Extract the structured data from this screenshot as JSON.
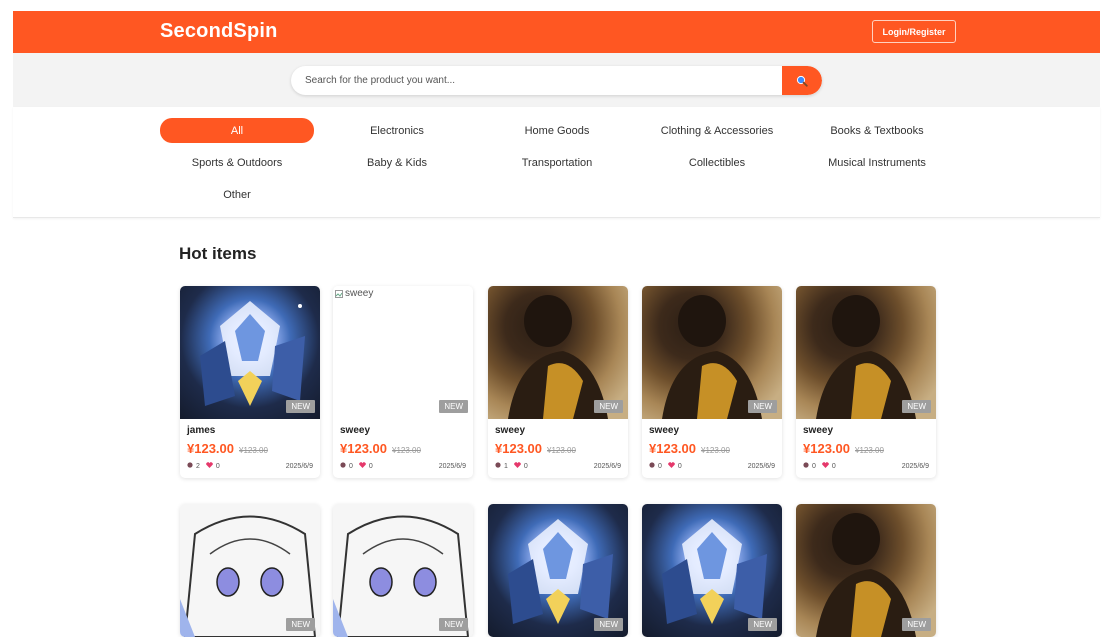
{
  "header": {
    "logo": "SecondSpin",
    "login_label": "Login/Register",
    "bg_color": "#ff5722"
  },
  "search": {
    "placeholder": "Search for the product you want...",
    "button_icon": "search-icon"
  },
  "categories": [
    {
      "label": "All",
      "active": true
    },
    {
      "label": "Electronics"
    },
    {
      "label": "Home Goods"
    },
    {
      "label": "Clothing & Accessories"
    },
    {
      "label": "Books & Textbooks"
    },
    {
      "label": "Sports & Outdoors"
    },
    {
      "label": "Baby & Kids"
    },
    {
      "label": "Transportation"
    },
    {
      "label": "Collectibles"
    },
    {
      "label": "Musical Instruments"
    },
    {
      "label": "Other"
    }
  ],
  "section_title": "Hot items",
  "items": [
    {
      "title": "james",
      "price": "¥123.00",
      "orig_price": "¥123.00",
      "views": "2",
      "likes": "0",
      "date": "2025/6/9",
      "badge": "NEW",
      "image": "mecha"
    },
    {
      "title": "sweey",
      "price": "¥123.00",
      "orig_price": "¥123.00",
      "views": "0",
      "likes": "0",
      "date": "2025/6/9",
      "badge": "NEW",
      "image": "broken",
      "alt": "sweey"
    },
    {
      "title": "sweey",
      "price": "¥123.00",
      "orig_price": "¥123.00",
      "views": "1",
      "likes": "0",
      "date": "2025/6/9",
      "badge": "NEW",
      "image": "person"
    },
    {
      "title": "sweey",
      "price": "¥123.00",
      "orig_price": "¥123.00",
      "views": "0",
      "likes": "0",
      "date": "2025/6/9",
      "badge": "NEW",
      "image": "person"
    },
    {
      "title": "sweey",
      "price": "¥123.00",
      "orig_price": "¥123.00",
      "views": "0",
      "likes": "0",
      "date": "2025/6/9",
      "badge": "NEW",
      "image": "person"
    },
    {
      "badge": "NEW",
      "image": "sketch"
    },
    {
      "badge": "NEW",
      "image": "sketch"
    },
    {
      "badge": "NEW",
      "image": "mecha"
    },
    {
      "badge": "NEW",
      "image": "mecha"
    },
    {
      "badge": "NEW",
      "image": "person"
    }
  ]
}
